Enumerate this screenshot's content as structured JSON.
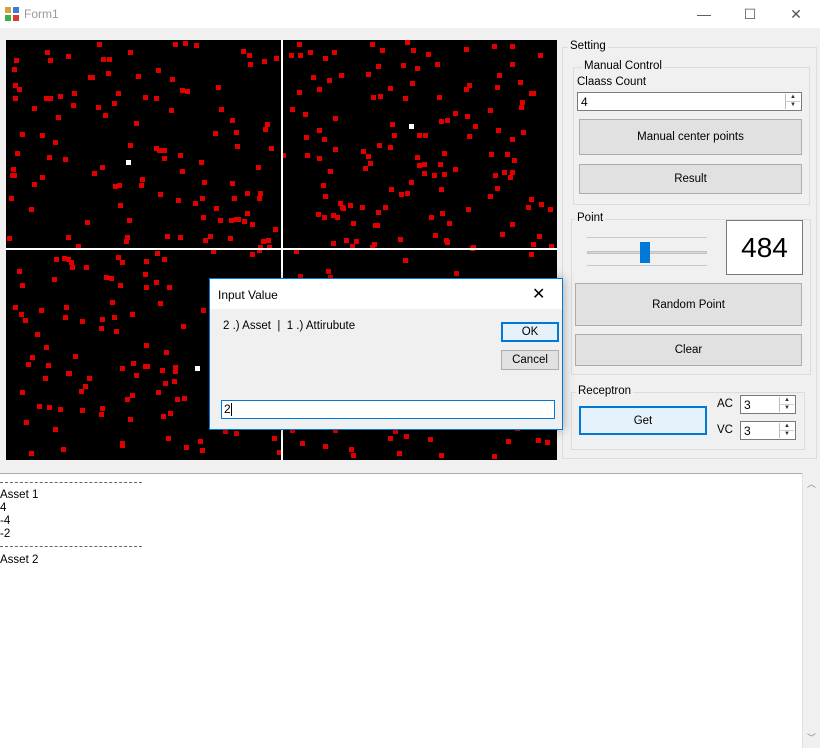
{
  "window": {
    "title": "Form1",
    "minimize_glyph": "—",
    "maximize_glyph": "☐",
    "close_glyph": "✕"
  },
  "colors": {
    "canvas_bg": "#000000",
    "point": "#e00000",
    "center": "#ffffff",
    "accent": "#0078d7"
  },
  "setting": {
    "label": "Setting",
    "manual_control": {
      "label": "Manual Control",
      "class_count_label": "Claass Count",
      "class_count_value": "4",
      "manual_button": "Manual center points",
      "result_button": "Result"
    },
    "point": {
      "label": "Point",
      "slider_value": 484,
      "count_display": "484",
      "random_button": "Random Point",
      "clear_button": "Clear"
    },
    "receptron": {
      "label": "Receptron",
      "get_button": "Get",
      "ac_label": "AC",
      "ac_value": "3",
      "vc_label": "VC",
      "vc_value": "3"
    }
  },
  "output": {
    "lines": [
      "Asset 1",
      "4",
      "-4",
      "-2",
      "Asset 2"
    ]
  },
  "dialog": {
    "title": "Input Value",
    "prompt": "2 .) Asset  |  1 .) Attirubute",
    "ok_button": "OK",
    "cancel_button": "Cancel",
    "input_value": "2",
    "close_glyph": "✕"
  }
}
